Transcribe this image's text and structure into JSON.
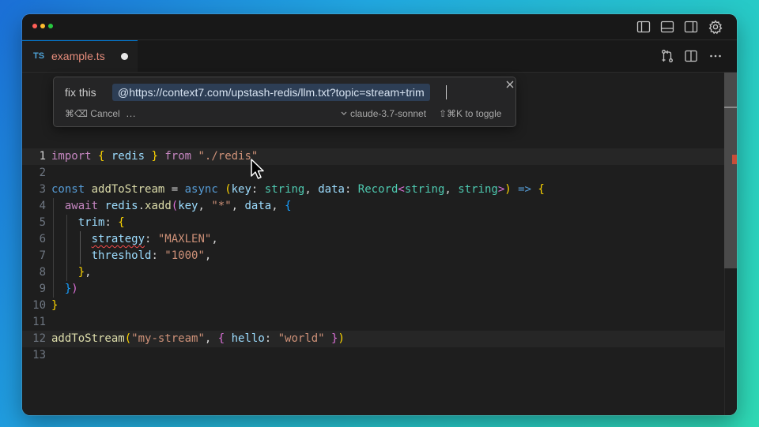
{
  "tab": {
    "lang_badge": "TS",
    "filename": "example.ts"
  },
  "popup": {
    "prefix": "fix this",
    "context_chip": "@https://context7.com/upstash-redis/llm.txt?topic=stream+trim",
    "cancel_label": "⌘⌫ Cancel",
    "more_label": "…",
    "model_label": "claude-3.7-sonnet",
    "toggle_label": "⇧⌘K to toggle"
  },
  "line_numbers": [
    "1",
    "2",
    "3",
    "4",
    "5",
    "6",
    "7",
    "8",
    "9",
    "10",
    "11",
    "12",
    "13"
  ],
  "code": {
    "l1": {
      "kw_import": "import",
      "brace_open": "{",
      "name": " redis ",
      "brace_close": "}",
      "kw_from": " from ",
      "path": "\"./redis\""
    },
    "l3": {
      "kw_const": "const",
      "fn_name": " addToStream",
      "eq": " = ",
      "kw_async": "async",
      "paren_open": " (",
      "p_key": "key",
      "colon1": ": ",
      "t_string1": "string",
      "comma1": ", ",
      "p_data": "data",
      "colon2": ": ",
      "t_record": "Record",
      "lt": "<",
      "t_string2": "string",
      "comma2": ", ",
      "t_string3": "string",
      "gt": ">",
      "paren_close": ")",
      "arrow": " => ",
      "brace_open": "{"
    },
    "l4": {
      "kw_await": "await",
      "obj": " redis",
      "dot": ".",
      "method": "xadd",
      "paren_open": "(",
      "arg_key": "key",
      "comma1": ", ",
      "arg_star": "\"*\"",
      "comma2": ", ",
      "arg_data": "data",
      "comma3": ", ",
      "brace_open": "{"
    },
    "l5": {
      "prop": "trim",
      "colon": ": ",
      "brace_open": "{"
    },
    "l6": {
      "prop": "strategy",
      "colon": ": ",
      "value": "\"MAXLEN\"",
      "comma": ","
    },
    "l7": {
      "prop": "threshold",
      "colon": ": ",
      "value": "\"1000\"",
      "comma": ","
    },
    "l8": {
      "brace_close": "}",
      "comma": ","
    },
    "l9": {
      "brace_close": "}",
      "paren_close": ")"
    },
    "l10": {
      "brace_close": "}"
    },
    "l12": {
      "fn_name": "addToStream",
      "paren_open": "(",
      "arg_stream": "\"my-stream\"",
      "comma": ", ",
      "brace_open": "{",
      "prop": " hello",
      "colon": ": ",
      "value": "\"world\"",
      "brace_close": " }",
      "paren_close": ")"
    }
  },
  "icons": {
    "titlebar": [
      "toggle-primary-sidebar-icon",
      "toggle-panel-icon",
      "toggle-secondary-sidebar-icon",
      "gear-icon"
    ],
    "editor_actions": [
      "open-changes-icon",
      "split-editor-icon",
      "more-actions-icon"
    ]
  },
  "colors": {
    "accent": "#0078d4",
    "tab_modified_name": "#e58c7b",
    "error": "#f14c4c"
  }
}
